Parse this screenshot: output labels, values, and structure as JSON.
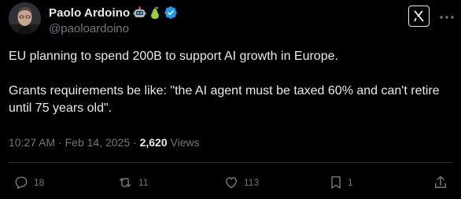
{
  "author": {
    "name": "Paolo Ardoino",
    "handle": "@paoloardoino",
    "name_emojis": [
      "robot-emoji-icon",
      "pear-emoji-icon"
    ],
    "verified_color": "#1d9bf0"
  },
  "tweet": {
    "line1": "EU planning to spend 200B to support AI growth in Europe.",
    "line2": "Grants requirements be like: \"the AI agent must be taxed 60% and can't retire until 75 years old\"."
  },
  "meta": {
    "time": "10:27 AM",
    "separator": "·",
    "date": "Feb 14, 2025",
    "views_count": "2,620",
    "views_label": "Views"
  },
  "actions": {
    "replies": "18",
    "reposts": "11",
    "likes": "113",
    "bookmarks": "1"
  },
  "colors": {
    "background": "#000000",
    "text": "#e7e9ea",
    "muted": "#71767b",
    "divider": "#2f3336",
    "verified": "#1d9bf0"
  }
}
